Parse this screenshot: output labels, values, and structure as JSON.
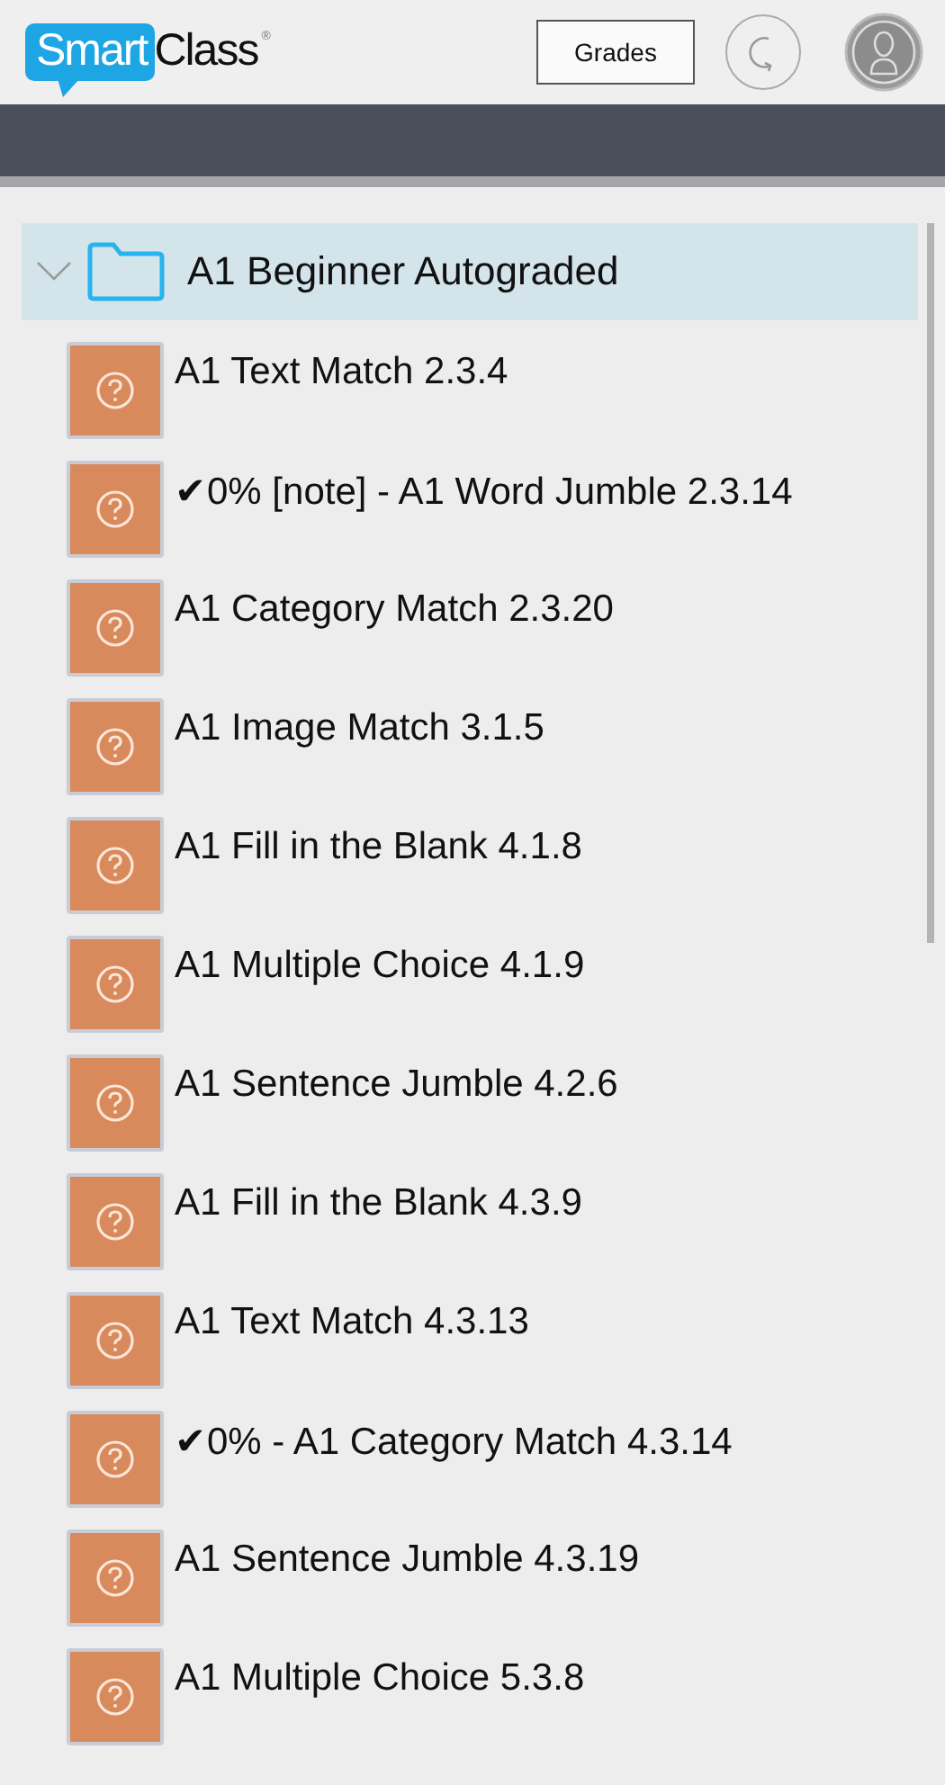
{
  "header": {
    "logo": {
      "part_1": "Smart",
      "part_2": "Class",
      "mark": "®"
    },
    "grades_button": "Grades"
  },
  "folder": {
    "label": "A1 Beginner Autograded",
    "expanded": true,
    "items": [
      {
        "label": "A1 Text Match 2.3.4"
      },
      {
        "label": "✔0% [note] - A1 Word Jumble 2.3.14"
      },
      {
        "label": "A1 Category Match 2.3.20"
      },
      {
        "label": "A1 Image Match 3.1.5"
      },
      {
        "label": "A1 Fill in the Blank 4.1.8"
      },
      {
        "label": "A1 Multiple Choice 4.1.9"
      },
      {
        "label": "A1 Sentence Jumble 4.2.6"
      },
      {
        "label": "A1 Fill in the Blank 4.3.9"
      },
      {
        "label": "A1 Text Match 4.3.13"
      },
      {
        "label": "✔0% - A1 Category Match 4.3.14"
      },
      {
        "label": "A1 Sentence Jumble 4.3.19"
      },
      {
        "label": "A1 Multiple Choice 5.3.8"
      }
    ]
  }
}
